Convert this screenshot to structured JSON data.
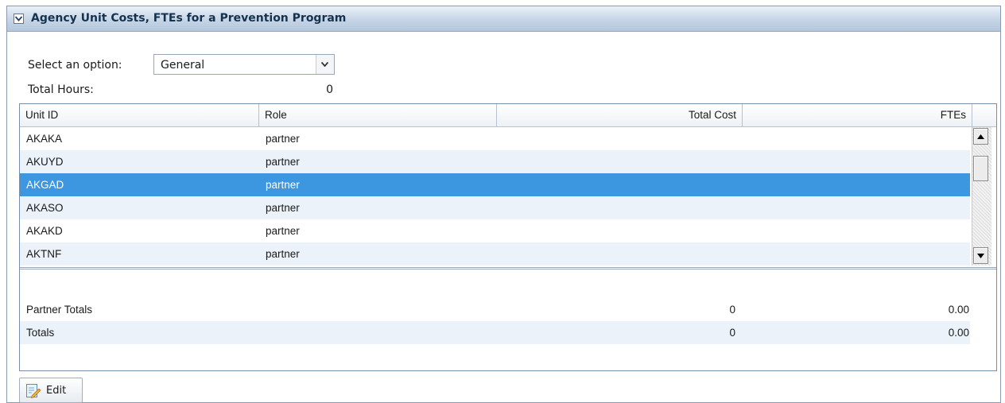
{
  "panel": {
    "title": "Agency Unit Costs, FTEs for a Prevention Program"
  },
  "option": {
    "label": "Select an option:",
    "selected": "General"
  },
  "total_hours": {
    "label": "Total Hours:",
    "value": "0"
  },
  "grid": {
    "columns": [
      "Unit ID",
      "Role",
      "Total Cost",
      "FTEs"
    ],
    "rows": [
      {
        "unit_id": "AKAKA",
        "role": "partner"
      },
      {
        "unit_id": "AKUYD",
        "role": "partner"
      },
      {
        "unit_id": "AKGAD",
        "role": "partner"
      },
      {
        "unit_id": "AKASO",
        "role": "partner"
      },
      {
        "unit_id": "AKAKD",
        "role": "partner"
      },
      {
        "unit_id": "AKTNF",
        "role": "partner"
      }
    ],
    "selected_row": "AKGAD",
    "totals": [
      {
        "label": "Partner Totals",
        "total_cost": "0",
        "ftes": "0.00"
      },
      {
        "label": "Totals",
        "total_cost": "0",
        "ftes": "0.00"
      }
    ]
  },
  "actions": {
    "edit_label": "Edit"
  },
  "colors": {
    "header": "#c6d5e6",
    "selection": "#3d96e0",
    "alt_row": "#ecf2fa"
  },
  "icons": [
    "collapse-icon",
    "chevron-down-icon",
    "scroll-up-icon",
    "scroll-down-icon",
    "edit-icon"
  ]
}
